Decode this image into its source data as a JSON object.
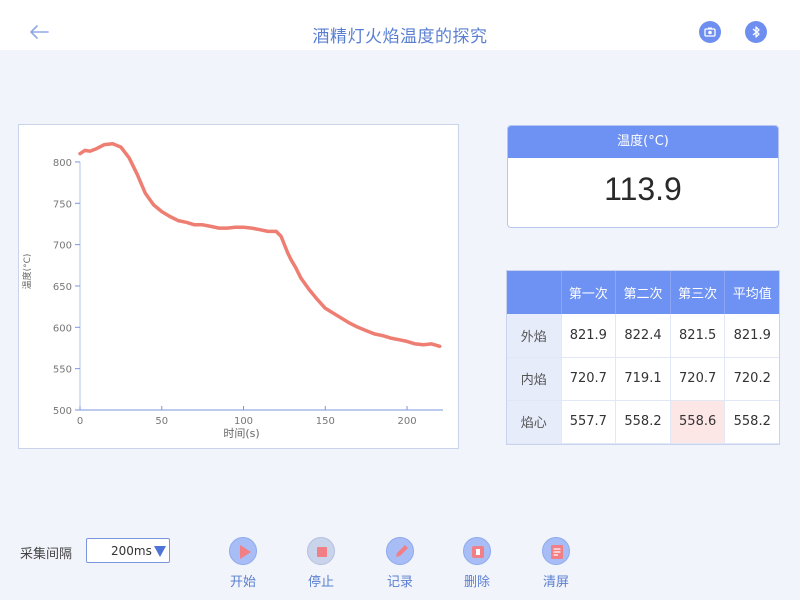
{
  "header": {
    "title": "酒精灯火焰温度的探究",
    "icons": [
      "back-arrow-icon",
      "camera-icon",
      "bluetooth-icon"
    ],
    "accent_color": "#6e92f3"
  },
  "temperature": {
    "label": "温度(°C)",
    "value": "113.9"
  },
  "stats_table": {
    "columns": [
      "",
      "第一次",
      "第二次",
      "第三次",
      "平均值"
    ],
    "rows": [
      {
        "label": "外焰",
        "values": [
          "821.9",
          "822.4",
          "821.5",
          "821.9"
        ]
      },
      {
        "label": "内焰",
        "values": [
          "720.7",
          "719.1",
          "720.7",
          "720.2"
        ]
      },
      {
        "label": "焰心",
        "values": [
          "557.7",
          "558.2",
          "558.6",
          "558.2"
        ]
      }
    ],
    "highlight_color": "#fce6e6"
  },
  "controls": {
    "interval_label": "采集间隔",
    "interval_value": "200ms",
    "buttons": [
      {
        "id": "start",
        "label": "开始",
        "icon": "play-icon"
      },
      {
        "id": "stop",
        "label": "停止",
        "icon": "stop-icon"
      },
      {
        "id": "record",
        "label": "记录",
        "icon": "pencil-icon"
      },
      {
        "id": "delete",
        "label": "删除",
        "icon": "delete-icon"
      },
      {
        "id": "clear",
        "label": "清屏",
        "icon": "clear-screen-icon"
      }
    ]
  },
  "chart_data": {
    "type": "line",
    "xlabel": "时间(s)",
    "ylabel": "温度(°C)",
    "xlim": [
      0,
      222
    ],
    "ylim": [
      500,
      835
    ],
    "xticks": [
      0,
      50,
      100,
      150,
      200
    ],
    "yticks": [
      500,
      550,
      600,
      650,
      700,
      750,
      800
    ],
    "grid": false,
    "line_color": "#ee7d72",
    "series": [
      {
        "x": [
          0,
          3,
          6,
          10,
          15,
          20,
          25,
          30,
          35,
          40,
          45,
          50,
          55,
          60,
          65,
          70,
          75,
          80,
          85,
          90,
          95,
          100,
          105,
          110,
          115,
          120,
          123,
          125,
          127,
          129,
          132,
          135,
          140,
          145,
          150,
          155,
          160,
          165,
          170,
          175,
          180,
          185,
          190,
          195,
          200,
          205,
          210,
          215,
          220
        ],
        "y": [
          810,
          814,
          813,
          816,
          821,
          822,
          818,
          805,
          785,
          762,
          748,
          740,
          734,
          729,
          727,
          724,
          724,
          722,
          720,
          720,
          721,
          721,
          720,
          718,
          716,
          716,
          710,
          700,
          690,
          682,
          672,
          660,
          646,
          634,
          623,
          617,
          611,
          605,
          600,
          596,
          592,
          590,
          587,
          585,
          583,
          580,
          579,
          580,
          577
        ]
      }
    ]
  }
}
